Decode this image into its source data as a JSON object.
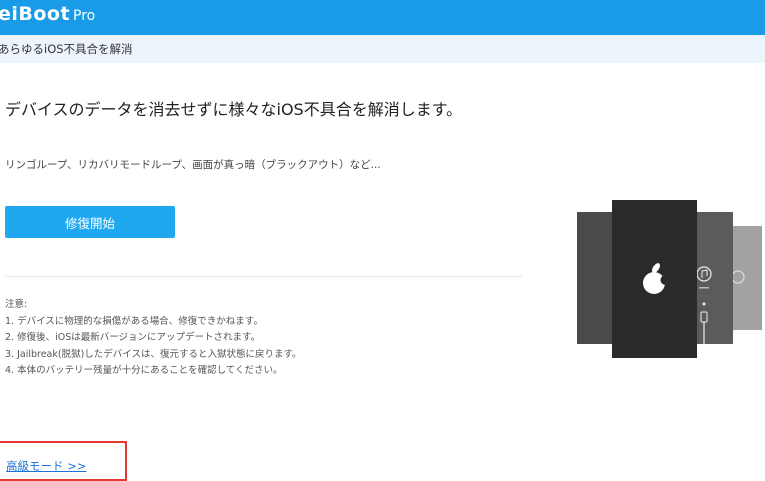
{
  "header": {
    "app_name": "eiBoot",
    "edition": "Pro"
  },
  "subbar": {
    "label": "あらゆるiOS不具合を解消"
  },
  "main": {
    "headline": "デバイスのデータを消去せずに様々なiOS不具合を解消します。",
    "examples": "リンゴループ、リカバリモードループ、画面が真っ暗（ブラックアウト）など...",
    "repair_button": "修復開始",
    "notes": {
      "title": "注意:",
      "items": [
        "1. デバイスに物理的な損傷がある場合、修復できかねます。",
        "2. 修復後、iOSは最新バージョンにアップデートされます。",
        "3. Jailbreak(脱獄)したデバイスは、復元すると入獄状態に戻ります。",
        "4. 本体のバッテリー残量が十分にあることを確認してください。"
      ]
    },
    "advanced_link": "高級モード >>"
  },
  "colors": {
    "header_bg": "#1a9be8",
    "subbar_bg": "#edf4fb",
    "button_bg": "#1fa8f0",
    "link": "#1a73d9",
    "highlight_frame": "#e53935"
  },
  "icons": [
    "apple-logo-icon",
    "itunes-icon",
    "usb-cable-icon"
  ]
}
